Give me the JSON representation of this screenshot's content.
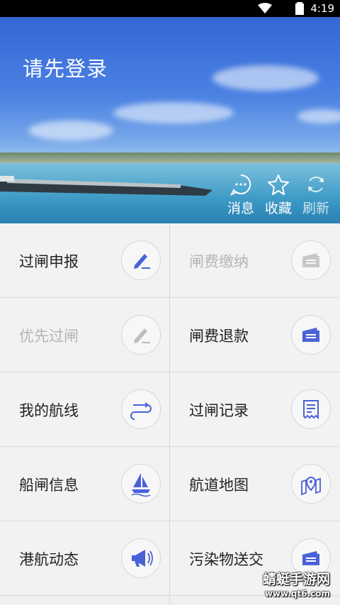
{
  "status_bar": {
    "time": "4:19"
  },
  "header": {
    "login_text": "请先登录",
    "actions": [
      {
        "label": "消息",
        "icon": "message-icon"
      },
      {
        "label": "收藏",
        "icon": "star-icon"
      },
      {
        "label": "刷新",
        "icon": "refresh-icon"
      }
    ]
  },
  "grid": {
    "items": [
      {
        "label": "过闸申报",
        "icon": "pen-icon",
        "enabled": true
      },
      {
        "label": "闸费缴纳",
        "icon": "ticket-icon",
        "enabled": false
      },
      {
        "label": "优先过闸",
        "icon": "pen-icon",
        "enabled": false
      },
      {
        "label": "闸费退款",
        "icon": "ticket-icon",
        "enabled": true
      },
      {
        "label": "我的航线",
        "icon": "route-icon",
        "enabled": true
      },
      {
        "label": "过闸记录",
        "icon": "receipt-icon",
        "enabled": true
      },
      {
        "label": "船闸信息",
        "icon": "sailboat-icon",
        "enabled": true
      },
      {
        "label": "航道地图",
        "icon": "map-pin-icon",
        "enabled": true
      },
      {
        "label": "港航动态",
        "icon": "megaphone-icon",
        "enabled": true
      },
      {
        "label": "污染物送交",
        "icon": "ticket-icon",
        "enabled": true
      }
    ]
  },
  "watermark": {
    "line1": "蜻蜓手游网",
    "line2": "www.qt6.com"
  },
  "colors": {
    "accent": "#4a62d8",
    "disabled": "#b5b5b5"
  }
}
